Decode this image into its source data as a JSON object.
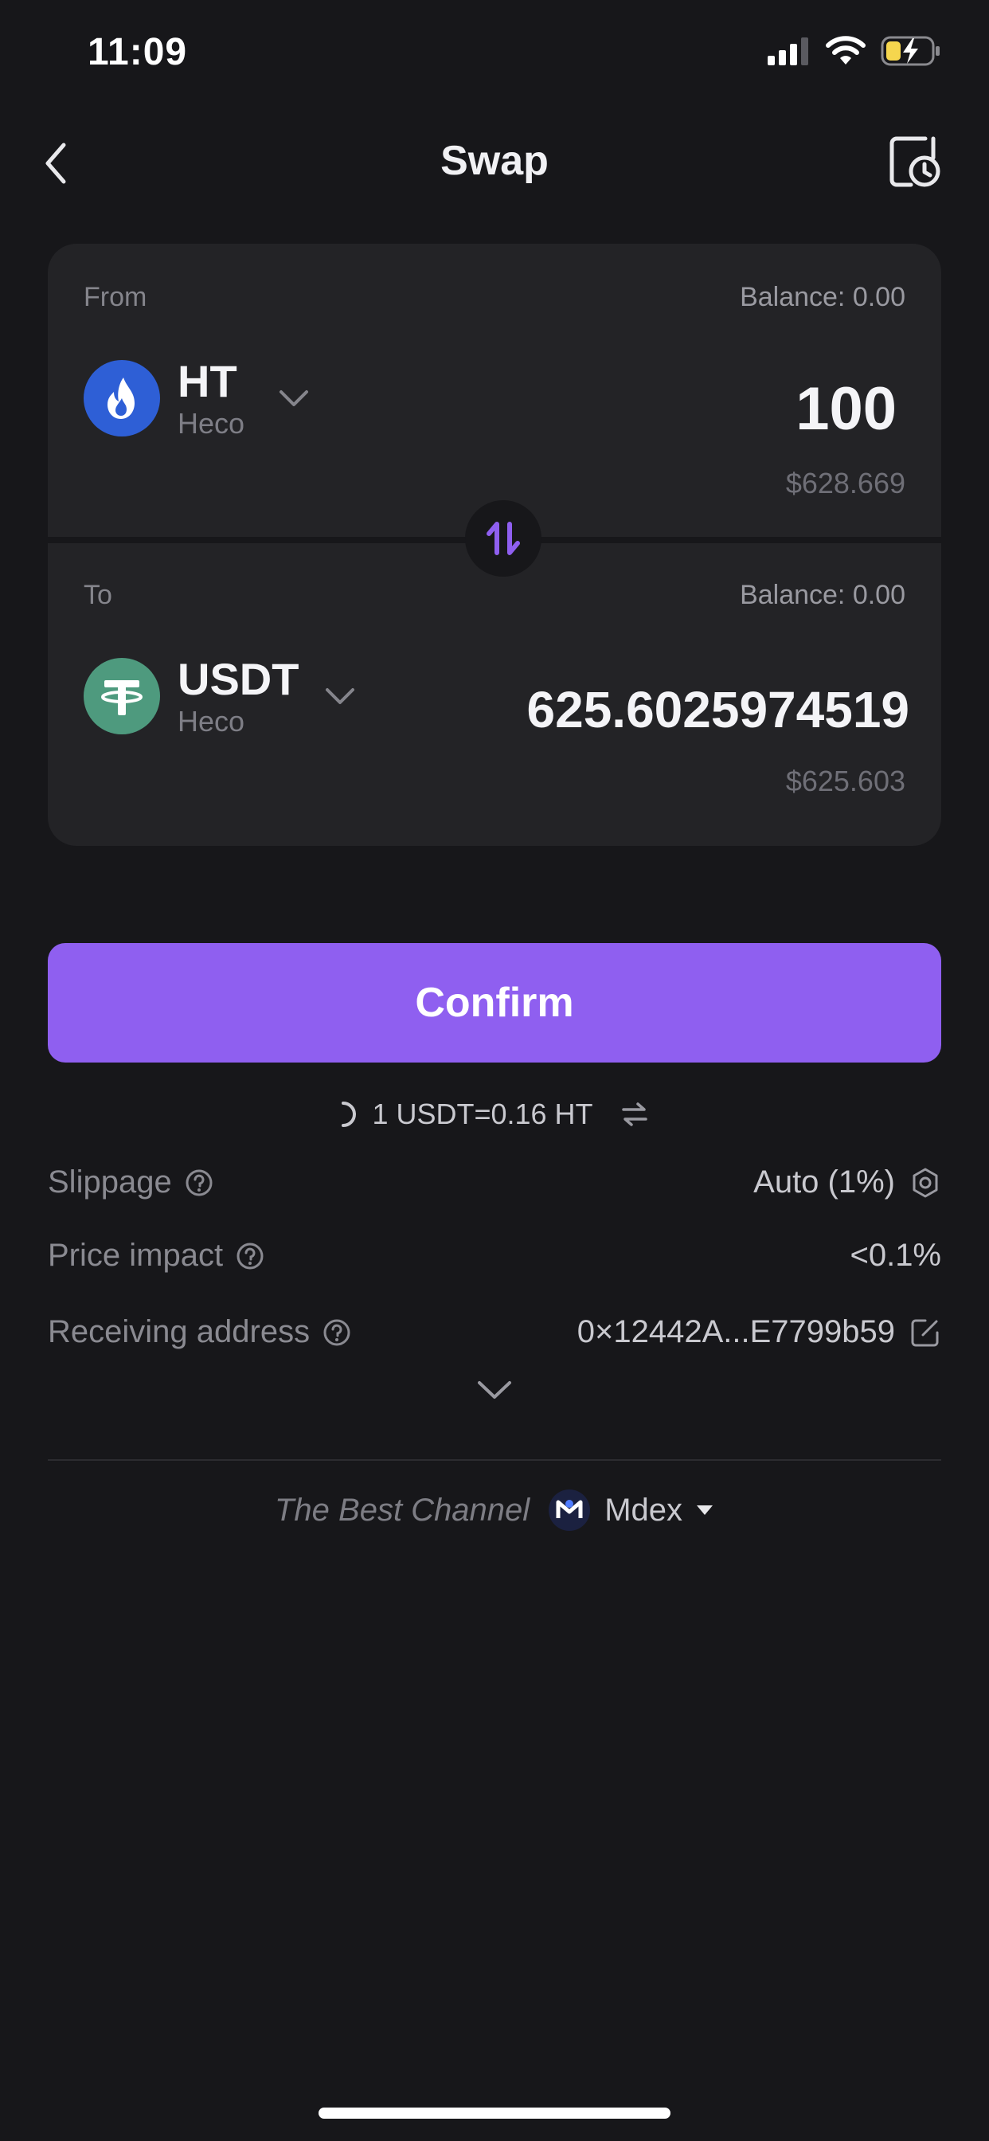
{
  "status_bar": {
    "time": "11:09"
  },
  "header": {
    "title": "Swap"
  },
  "from": {
    "label": "From",
    "balance": "Balance: 0.00",
    "token_symbol": "HT",
    "network": "Heco",
    "amount": "100",
    "fiat": "$628.669",
    "icon_color": "#2e5fd6"
  },
  "to": {
    "label": "To",
    "balance": "Balance: 0.00",
    "token_symbol": "USDT",
    "network": "Heco",
    "amount": "625.6025974519",
    "fiat": "$625.603",
    "icon_color": "#4e9a7e"
  },
  "confirm": {
    "label": "Confirm"
  },
  "rate": {
    "text": "1 USDT=0.16 HT"
  },
  "details": {
    "slippage_label": "Slippage",
    "slippage_value": "Auto (1%)",
    "price_impact_label": "Price impact",
    "price_impact_value": "<0.1%",
    "receiving_label": "Receiving address",
    "receiving_value": "0×12442A...E7799b59"
  },
  "channel": {
    "label": "The Best Channel",
    "dex": "Mdex"
  },
  "colors": {
    "accent": "#8f5ff0",
    "background": "#17171a",
    "card": "#232326"
  }
}
